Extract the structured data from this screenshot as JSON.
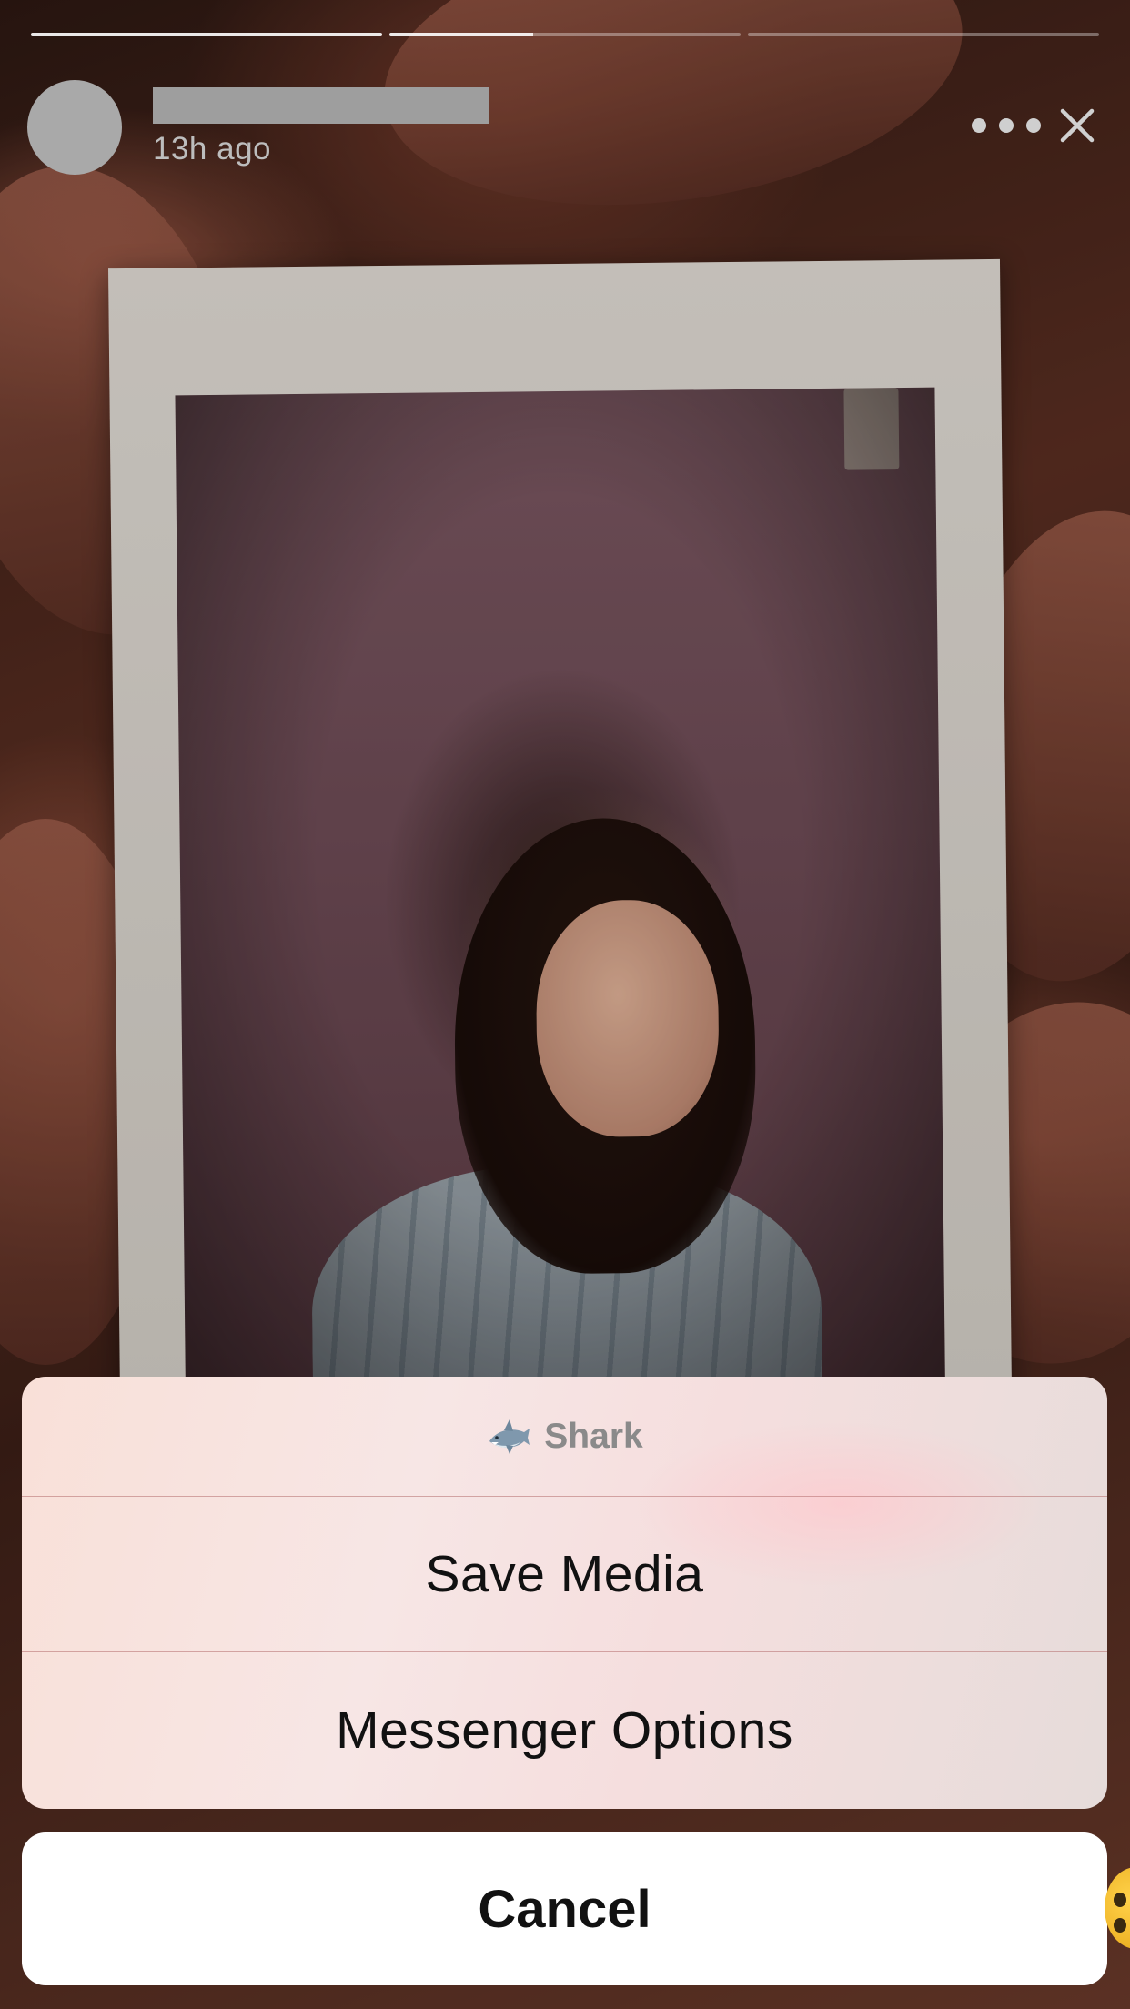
{
  "story": {
    "progress": [
      {
        "fill": 1.0
      },
      {
        "fill": 0.41
      },
      {
        "fill": 0.0
      }
    ],
    "header": {
      "timestamp": "13h ago",
      "more_icon": "more-horizontal-icon",
      "close_icon": "close-icon"
    },
    "image_description": "instant-photo-held-in-hand"
  },
  "action_sheet": {
    "header_icon": "shark-emoji-icon",
    "title": "Shark",
    "options": [
      {
        "label": "Save Media"
      },
      {
        "label": "Messenger Options"
      }
    ],
    "cancel_label": "Cancel"
  },
  "colors": {
    "sheet_text": "#111111",
    "sheet_title": "#8a8a8a",
    "divider": "#b46e6e",
    "cancel_bg": "#ffffff"
  }
}
